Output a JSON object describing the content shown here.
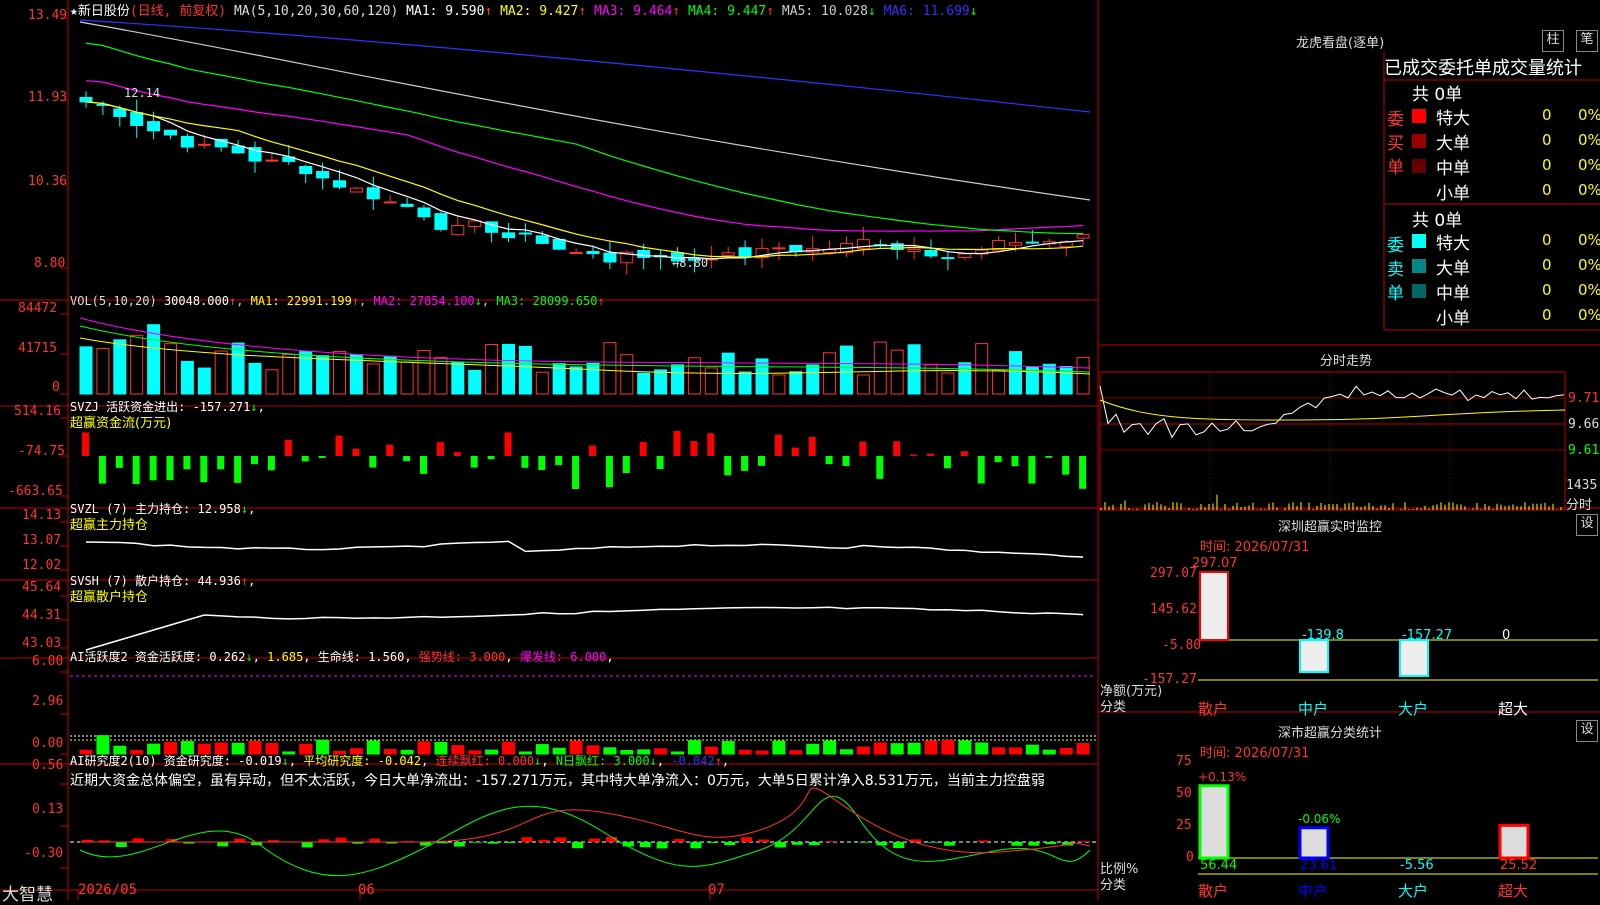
{
  "main": {
    "title_prefix": "★新日股份",
    "period": "(日线, 前复权)",
    "ma_header": "MA(5,10,20,30,60,120)",
    "ma": [
      {
        "label": "MA1: 9.590",
        "arrow": "↑",
        "color": "#ffffff"
      },
      {
        "label": "MA2: 9.427",
        "arrow": "↑",
        "color": "#ffff00"
      },
      {
        "label": "MA3: 9.464",
        "arrow": "↑",
        "color": "#ff00ff"
      },
      {
        "label": "MA4: 9.447",
        "arrow": "↑",
        "color": "#00ff00"
      },
      {
        "label": "MA5: 10.028",
        "arrow": "↓",
        "color": "#cccccc"
      },
      {
        "label": "MA6: 11.699",
        "arrow": "↓",
        "color": "#3333ff"
      }
    ],
    "y_ticks": [
      "13.49",
      "11.93",
      "10.36",
      "8.80"
    ],
    "high_mark": "12.14",
    "low_mark": "←8.80",
    "dates": [
      "2026/05",
      "06",
      "07"
    ],
    "logo": "大智慧"
  },
  "vol": {
    "header": "VOL(5,10,20)",
    "value": "30048.000",
    "ma1": "MA1: 22991.199",
    "ma2": "MA2: 27854.100",
    "ma3": "MA3: 28099.650",
    "y_ticks": [
      "84472",
      "41715",
      "0"
    ]
  },
  "svzj": {
    "header": "SVZJ  活跃资金进出: -157.271",
    "sub": "超赢资金流(万元)",
    "y_ticks": [
      "514.16",
      "-74.75",
      "-663.65"
    ]
  },
  "svzl": {
    "header": "SVZL (7) 主力持仓: 12.958",
    "sub": "超赢主力持仓",
    "y_ticks": [
      "14.13",
      "13.07",
      "12.02"
    ]
  },
  "svsh": {
    "header": "SVSH (7) 散户持仓: 44.936",
    "sub": "超赢散户持仓",
    "y_ticks": [
      "45.64",
      "44.31",
      "43.03"
    ]
  },
  "ai1": {
    "header": "AI活跃度2 资金活跃度: 0.262",
    "v2": "1.685",
    "v3": "生命线: 1.560",
    "v4": "强势线: 3.000",
    "v5": "爆发线: 6.000",
    "y_ticks": [
      "6.00",
      "2.96",
      "0.00"
    ]
  },
  "ai2": {
    "header": "AI研究度2(10) 资金研究度: -0.019",
    "v2": "平均研究度: -0.042",
    "v3": "连续飘红: 0.000",
    "v4": "N日飘红: 3.000",
    "v5": "-0.042",
    "desc": "近期大资金总体偏空，虽有异动，但不太活跃，今日大单净流出：-157.271万元，其中特大单净流入：0万元，大单5日累计净入8.531万元，当前主力控盘弱",
    "y_ticks": [
      "0.56",
      "0.13",
      "-0.30"
    ]
  },
  "dragon": {
    "title": "龙虎看盘(逐单)",
    "btn_bar": "柱",
    "btn_pen": "笔",
    "tabs": "已成交委托单成交量统计",
    "buy_side": "委买单",
    "sell_side": "委卖单",
    "buy_total": "共 0单",
    "sell_total": "共 0单",
    "rows": [
      "特大",
      "大单",
      "中单",
      "小单"
    ],
    "buy_colors": [
      "#ff0000",
      "#990000",
      "#660000",
      "#000000"
    ],
    "sell_colors": [
      "#00ffff",
      "#008888",
      "#006666",
      "#000000"
    ],
    "count": "0",
    "pct": "0%"
  },
  "intraday": {
    "title": "分时走势",
    "prices": [
      "9.71",
      "9.66",
      "9.61"
    ],
    "vol_max": "1435",
    "vol_unit": "分时"
  },
  "monitor": {
    "title": "深圳超赢实时监控",
    "btn": "设",
    "time": "时间: 2026/07/31",
    "y_ticks": [
      "297.07",
      "145.62",
      "-5.80",
      "-157.27"
    ],
    "y_label1": "净额(万元)",
    "y_label2": "分类",
    "cats": [
      "散户",
      "中户",
      "大户",
      "超大"
    ],
    "values": [
      297.07,
      -139.8,
      -157.27,
      0
    ],
    "value_labels": [
      "297.07",
      "-139.8",
      "-157.27",
      "0"
    ]
  },
  "stats": {
    "title": "深市超赢分类统计",
    "btn": "设",
    "time": "时间: 2026/07/31",
    "y_ticks": [
      "75",
      "50",
      "25",
      "0"
    ],
    "y_label1": "比例%",
    "y_label2": "分类",
    "cats": [
      "散户",
      "中户",
      "大户",
      "超大"
    ],
    "values": [
      56.44,
      23.61,
      -5.56,
      25.52
    ],
    "value_labels": [
      "56.44",
      "23.61",
      "-5.56",
      "25.52"
    ],
    "change_labels": [
      "+0.13%",
      "-0.06%"
    ]
  }
}
